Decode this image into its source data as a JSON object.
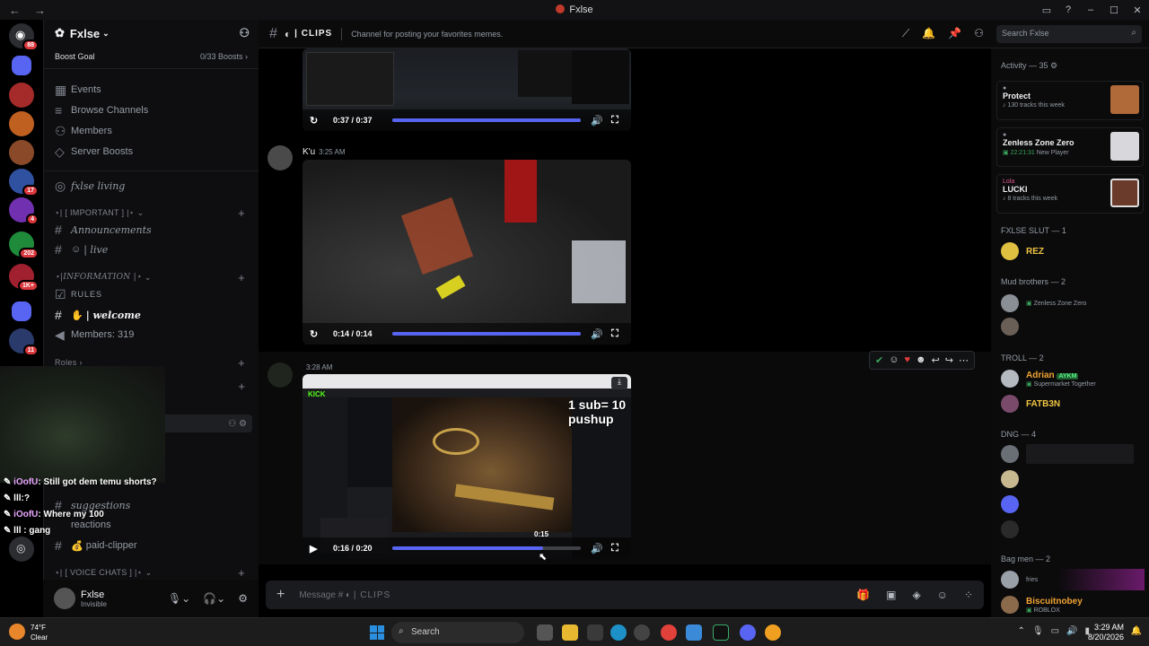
{
  "window": {
    "title": "Fxlse"
  },
  "server": {
    "name": "Fxlse",
    "boost_goal_label": "Boost Goal",
    "boost_count": "0/33 Boosts"
  },
  "rail_badges": [
    "88",
    "17",
    "4",
    "202",
    "1K+",
    "11"
  ],
  "sidebar": {
    "nav": [
      "Events",
      "Browse Channels",
      "Members",
      "Server Boosts"
    ],
    "channels": {
      "fxlse_living": "fxlse living",
      "important_cat": "⋆| [ IMPORTANT ] |⋆",
      "announcements": "Announcements",
      "live": "| live",
      "information_cat": "⋆|INFORMATION |⋆",
      "rules": "RULES",
      "welcome": "| welcome",
      "members": "Members: 319",
      "roles": "Roles",
      "suggestions": "suggestions",
      "reactions": "reactions",
      "paid_clipper": "paid-clipper",
      "voice_cat": "⋆| [ VOICE CHATS ] |⋆"
    }
  },
  "overlay": {
    "messages": [
      {
        "user": "iOofU",
        "text": ": Still got dem temu shorts?"
      },
      {
        "user": "",
        "text": "lll:?"
      },
      {
        "user": "iOofU",
        "text": ": Where my 100"
      },
      {
        "user": "",
        "text": "lll : gang"
      }
    ]
  },
  "user": {
    "name": "Fxlse",
    "status": "Invisible"
  },
  "channel": {
    "name": "| CLIPS",
    "topic": "Channel for posting your favorites memes."
  },
  "search": {
    "placeholder": "Search Fxlse"
  },
  "messages": [
    {
      "author": "",
      "time": "",
      "video_time": "0:37 / 0:37",
      "progress": 1.0
    },
    {
      "author": "K'u",
      "time": "3:25 AM",
      "video_time": "0:14 / 0:14",
      "progress": 1.0
    },
    {
      "author": "",
      "time": "3:28 AM",
      "video_time": "0:16 / 0:20",
      "progress": 0.8,
      "overlay_text": "1 sub= 10 pushup",
      "hover_time": "0:15",
      "site_label": "KICK"
    }
  ],
  "composer": {
    "placeholder": "Message #",
    "channel": "| CLIPS"
  },
  "members": {
    "activity_header": "Activity — 35",
    "activity": [
      {
        "title": "Protect",
        "sub": "130 tracks this week"
      },
      {
        "title": "Zenless Zone Zero",
        "sub": "22:21:31",
        "sub2": "New Player"
      },
      {
        "name": "Lola",
        "title": "LUCKI",
        "sub": "8 tracks this week"
      }
    ],
    "groups": [
      {
        "header": "FXLSE SLUT — 1",
        "members": [
          {
            "name": "REZ",
            "status": ""
          }
        ]
      },
      {
        "header": "Mud brothers — 2",
        "members": [
          {
            "name": "",
            "status": "Zenless Zone Zero"
          },
          {
            "name": "",
            "status": ""
          }
        ]
      },
      {
        "header": "TROLL — 2",
        "members": [
          {
            "name": "Adrian",
            "tag": "AYKM",
            "status": "Supermarket Together"
          },
          {
            "name": "FATB3N",
            "status": ""
          }
        ]
      },
      {
        "header": "DNG — 4",
        "members": []
      },
      {
        "header": "Bag men — 2",
        "members": [
          {
            "name": "",
            "status": "fries"
          },
          {
            "name": "Biscuitnobey",
            "status": "ROBLOX"
          }
        ]
      }
    ]
  },
  "taskbar": {
    "weather_temp": "74°F",
    "weather_desc": "Clear",
    "search": "Search",
    "time": "3:29 AM",
    "date": "8/20/2026"
  },
  "colors": {
    "accent": "#5865f2",
    "activity_lola": "#e0568e",
    "member_gold": "#f0c543",
    "member_orange": "#f0a232",
    "member_green": "#57f287"
  }
}
